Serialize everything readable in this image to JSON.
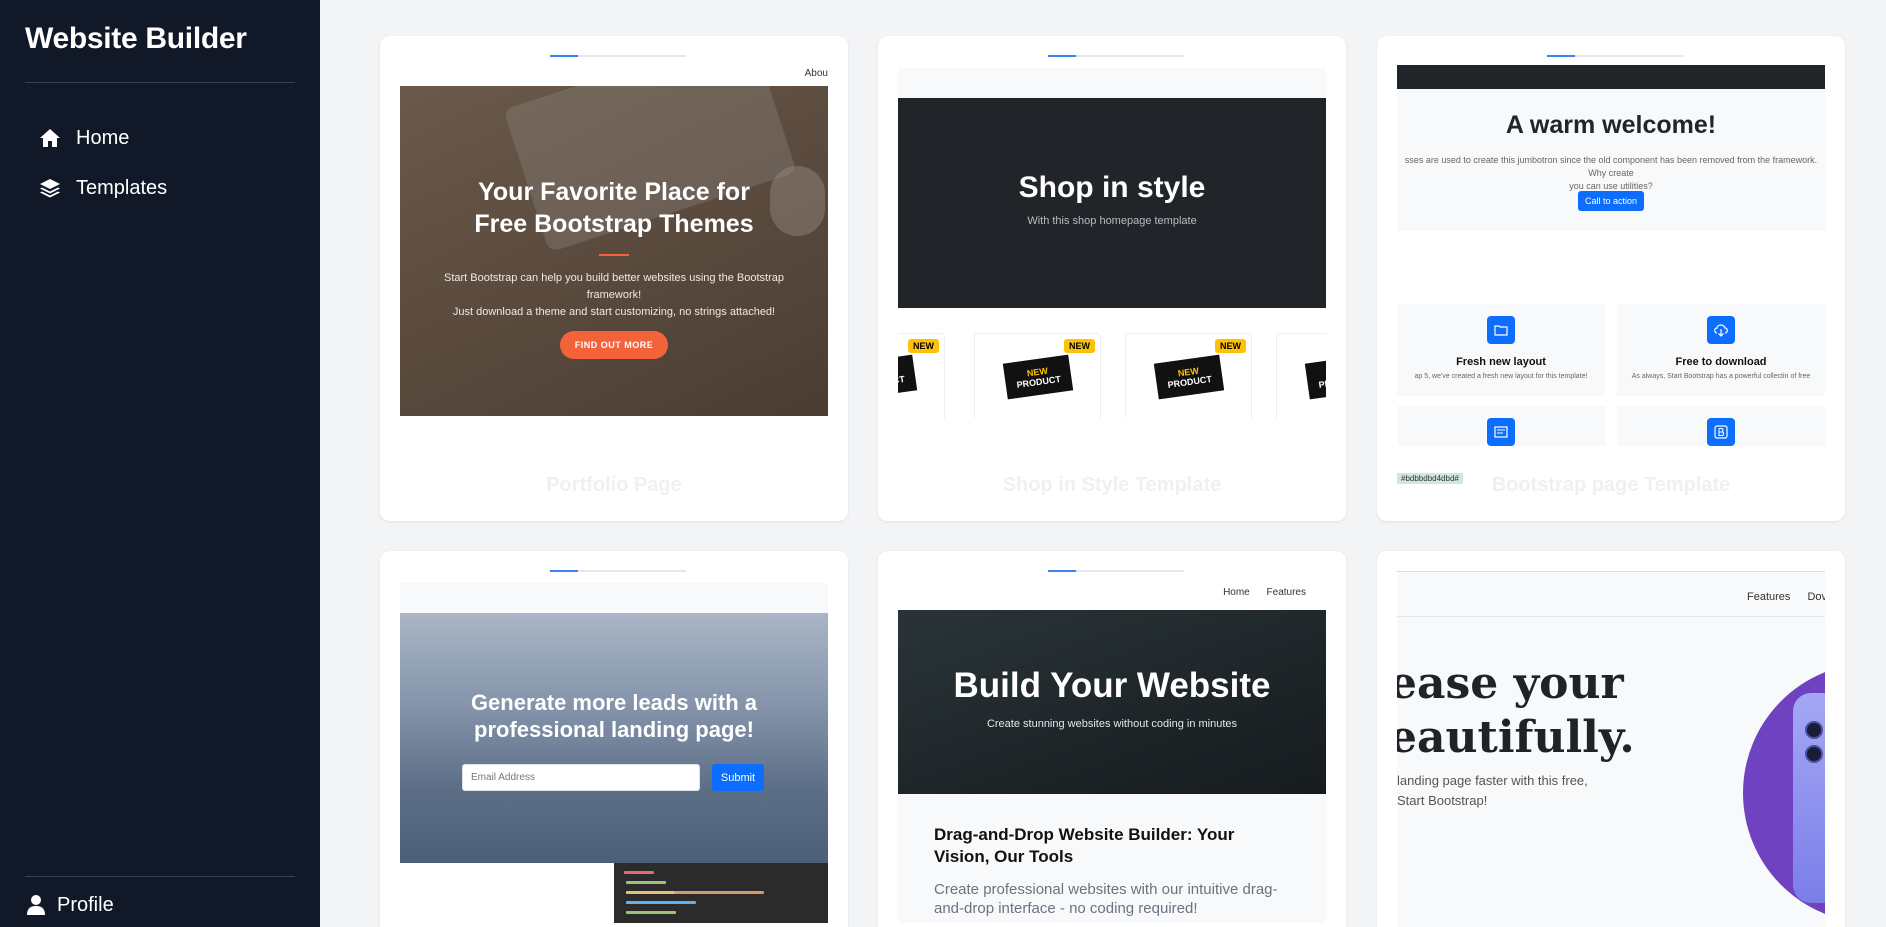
{
  "sidebar": {
    "brand": "Website Builder",
    "nav": [
      {
        "label": "Home",
        "icon": "home-icon"
      },
      {
        "label": "Templates",
        "icon": "layers-icon"
      }
    ],
    "profile": {
      "label": "Profile",
      "icon": "user-icon"
    }
  },
  "cards": [
    {
      "title": "Portfolio Page",
      "nav_text": "Abou",
      "heading_line1": "Your Favorite Place for",
      "heading_line2": "Free Bootstrap Themes",
      "text_line1": "Start Bootstrap can help you build better websites using the Bootstrap framework!",
      "text_line2": "Just download a theme and start customizing, no strings attached!",
      "button": "FIND OUT MORE"
    },
    {
      "title": "Shop in Style Template",
      "heading": "Shop in style",
      "subheading": "With this shop homepage template",
      "badge": "NEW",
      "product_line1": "NEW",
      "product_line2": "PRODUCT"
    },
    {
      "title": "Bootstrap page Template",
      "heading": "A warm welcome!",
      "text_line1": "sses are used to create this jumbotron since the old component has been removed from the framework. Why create",
      "text_line2": "you can use utilities?",
      "button": "Call to action",
      "features": [
        {
          "title": "Fresh new layout",
          "text": "ap 5, we've created a fresh new layout for this template!"
        },
        {
          "title": "Free to download",
          "text": "As always, Start Bootstrap has a powerful collectin of free"
        }
      ],
      "hash": "#bdbbdbd4dbd#"
    },
    {
      "heading_line1": "Generate more leads with a",
      "heading_line2": "professional landing page!",
      "email_placeholder": "Email Address",
      "button": "Submit"
    },
    {
      "nav": [
        "Home",
        "Features"
      ],
      "heading": "Build Your Website",
      "subheading": "Create stunning websites without coding in minutes",
      "post_title": "Drag-and-Drop Website Builder: Your Vision, Our Tools",
      "post_text": "Create professional websites with our intuitive drag-and-drop interface - no coding required!"
    },
    {
      "nav": [
        "Features",
        "Dov"
      ],
      "headline_line1": "ease your",
      "headline_line2": "eautifully.",
      "sub_line1": "landing page faster with this free,",
      "sub_line2": "Start Bootstrap!"
    }
  ]
}
